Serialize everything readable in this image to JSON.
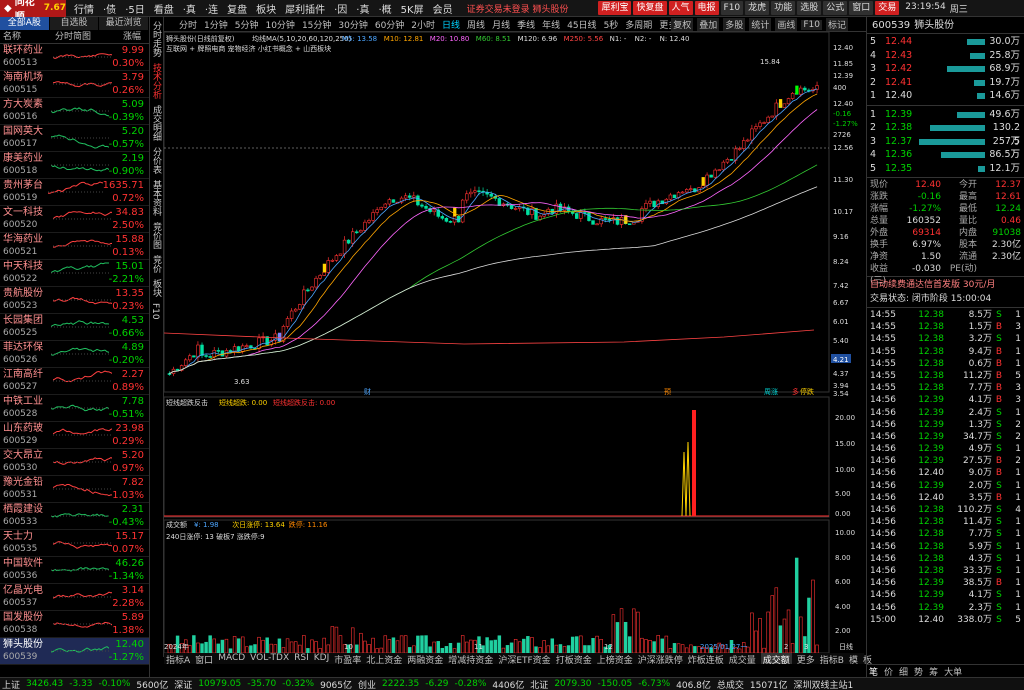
{
  "app": {
    "brand": "同花顺",
    "version": "7.67"
  },
  "menu": [
    "行情",
    "·债",
    "·5日",
    "看盘",
    "·真",
    "·连",
    "复盘",
    "板块",
    "犀利插件",
    "·因",
    "·真",
    "·概",
    "5K屏",
    "会员"
  ],
  "notice": "证券交易未登录  狮头股份",
  "toolbar_buttons": [
    {
      "label": "犀利宝",
      "bg": "#d02020",
      "fg": "#fff"
    },
    {
      "label": "快复盘",
      "bg": "#d02020",
      "fg": "#fff"
    },
    {
      "label": "人气",
      "bg": "#d02020",
      "fg": "#fff"
    },
    {
      "label": "电报",
      "bg": "#d02020",
      "fg": "#fff"
    },
    {
      "label": "F10",
      "bg": "#303030",
      "fg": "#ddd"
    },
    {
      "label": "龙虎",
      "bg": "#303030",
      "fg": "#ddd"
    },
    {
      "label": "功能",
      "bg": "#303030",
      "fg": "#ddd"
    },
    {
      "label": "选股",
      "bg": "#303030",
      "fg": "#ddd"
    },
    {
      "label": "公式",
      "bg": "#303030",
      "fg": "#ddd"
    },
    {
      "label": "窗口",
      "bg": "#303030",
      "fg": "#ddd"
    },
    {
      "label": "交易",
      "bg": "#d02020",
      "fg": "#fff"
    }
  ],
  "clock": {
    "time": "23:19:54",
    "weekday": "周三"
  },
  "left": {
    "tabs": [
      "全部A股",
      "自选股",
      "最近浏览"
    ],
    "headers": [
      "名称",
      "分时简图",
      "涨幅"
    ],
    "stocks": [
      {
        "name": "联环药业",
        "code": "600513",
        "price": "9.99",
        "chg": "0.30%",
        "up": true
      },
      {
        "name": "海南机场",
        "code": "600515",
        "price": "3.79",
        "chg": "0.26%",
        "up": true
      },
      {
        "name": "方大炭素",
        "code": "600516",
        "price": "5.09",
        "chg": "-0.39%",
        "up": false
      },
      {
        "name": "国网英大",
        "code": "600517",
        "price": "5.20",
        "chg": "-0.57%",
        "up": false
      },
      {
        "name": "康美药业",
        "code": "600518",
        "price": "2.19",
        "chg": "-0.90%",
        "up": false
      },
      {
        "name": "贵州茅台",
        "code": "600519",
        "price": "1635.71",
        "chg": "0.72%",
        "up": true
      },
      {
        "name": "文一科技",
        "code": "600520",
        "price": "34.83",
        "chg": "2.50%",
        "up": true
      },
      {
        "name": "华海药业",
        "code": "600521",
        "price": "15.88",
        "chg": "0.13%",
        "up": true
      },
      {
        "name": "中天科技",
        "code": "600522",
        "price": "15.01",
        "chg": "-2.21%",
        "up": false
      },
      {
        "name": "贵航股份",
        "code": "600523",
        "price": "13.35",
        "chg": "0.23%",
        "up": true
      },
      {
        "name": "长园集团",
        "code": "600525",
        "price": "4.53",
        "chg": "-0.66%",
        "up": false
      },
      {
        "name": "菲达环保",
        "code": "600526",
        "price": "4.89",
        "chg": "-0.20%",
        "up": false
      },
      {
        "name": "江南高纤",
        "code": "600527",
        "price": "2.27",
        "chg": "0.89%",
        "up": true
      },
      {
        "name": "中铁工业",
        "code": "600528",
        "price": "7.78",
        "chg": "-0.51%",
        "up": false
      },
      {
        "name": "山东药玻",
        "code": "600529",
        "price": "23.98",
        "chg": "0.29%",
        "up": true
      },
      {
        "name": "交大昂立",
        "code": "600530",
        "price": "5.20",
        "chg": "0.97%",
        "up": true
      },
      {
        "name": "豫光金铅",
        "code": "600531",
        "price": "7.82",
        "chg": "1.03%",
        "up": true
      },
      {
        "name": "栖霞建设",
        "code": "600533",
        "price": "2.31",
        "chg": "-0.43%",
        "up": false
      },
      {
        "name": "天士力",
        "code": "600535",
        "price": "15.17",
        "chg": "0.07%",
        "up": true
      },
      {
        "name": "中国软件",
        "code": "600536",
        "price": "46.26",
        "chg": "-1.34%",
        "up": false
      },
      {
        "name": "亿晶光电",
        "code": "600537",
        "price": "3.14",
        "chg": "2.28%",
        "up": true
      },
      {
        "name": "国发股份",
        "code": "600538",
        "price": "5.89",
        "chg": "1.38%",
        "up": true
      },
      {
        "name": "狮头股份",
        "code": "600539",
        "price": "12.40",
        "chg": "-1.27%",
        "up": false,
        "selected": true
      }
    ]
  },
  "vtabs": [
    "分时走势",
    "技术分析",
    "成交明细",
    "分价表",
    "基本资料",
    "竞价图",
    "竞价",
    "板块",
    "F10"
  ],
  "period_tabs": [
    "分时",
    "1分钟",
    "5分钟",
    "10分钟",
    "15分钟",
    "30分钟",
    "60分钟",
    "2小时",
    "日线",
    "周线",
    "月线",
    "季线",
    "年线",
    "45日线",
    "5秒",
    "多周期",
    "更多"
  ],
  "period_active": "日线",
  "chart_tools": [
    "复权",
    "叠加",
    "多股",
    "统计",
    "画线",
    "F10",
    "标记"
  ],
  "chart": {
    "stock_line": "狮头股份(日线前复权)",
    "ma_label": "均线MA(5,10,20,60,120,250)",
    "ma_values": [
      {
        "t": "M5: 13.58",
        "c": "#4da6ff"
      },
      {
        "t": "M10: 12.81",
        "c": "#ffa500"
      },
      {
        "t": "M20: 10.80",
        "c": "#ff66ff"
      },
      {
        "t": "M60: 8.51",
        "c": "#33cc33"
      },
      {
        "t": "M120: 6.96",
        "c": "#dddddd"
      },
      {
        "t": "M250: 5.56",
        "c": "#ff4444"
      },
      {
        "t": "N1: -",
        "c": "#ddd"
      },
      {
        "t": "N2: -",
        "c": "#ddd"
      },
      {
        "t": "N: 12.40",
        "c": "#ddd"
      }
    ],
    "tags": "互联网 + 牌照电商  宠物经济  小红书概念  + 山西板块",
    "high_mark": "15.84",
    "low_mark": "3.63",
    "last_tag": "4.21",
    "price_axis": [
      "12.40",
      "11.85",
      "12.39",
      "400",
      "12.40",
      "-0.16",
      "-1.27%",
      "2726",
      "12.56",
      "11.30",
      "10.17",
      "9.16",
      "8.24",
      "7.42",
      "6.67",
      "6.01",
      "5.40",
      "4.86",
      "4.37",
      "3.94",
      "3.54"
    ],
    "events": [
      {
        "t": "财",
        "c": "#4da6ff"
      },
      {
        "t": "预",
        "c": "#ff8800"
      },
      {
        "t": "周涨",
        "c": "#00d2d2"
      },
      {
        "t": "多",
        "c": "#ff3232"
      },
      {
        "t": "停跌",
        "c": "#ffd200"
      }
    ],
    "ind1_title": "短线超跌反击",
    "ind1_vals": [
      {
        "t": "短线超跌: 0.00",
        "c": "#ffd200"
      },
      {
        "t": "短线超跌反击: 0.00",
        "c": "#ff3232"
      }
    ],
    "ind1_axis": [
      "20.00",
      "15.00",
      "10.00",
      "5.00",
      "0.00"
    ],
    "vol_title": "成交额",
    "vol_vals": [
      {
        "t": "¥: 1.98",
        "c": "#4da6ff"
      },
      {
        "t": "次日涨停: 13.64",
        "c": "#ffd200"
      },
      {
        "t": "跌停: 11.16",
        "c": "#ff8800"
      }
    ],
    "vol_sub": "240日涨停: 13  破板7  涨跌停:9",
    "vol_axis": [
      "10.00",
      "8.00",
      "6.00",
      "4.00",
      "2.00"
    ],
    "date_labels": [
      "2024年",
      "10",
      "11",
      "12",
      "2025/01/27一",
      "2",
      "3"
    ],
    "corner": "日线"
  },
  "chart_data": {
    "type": "candlestick",
    "title": "狮头股份(日线前复权)",
    "high": 15.84,
    "low": 3.63,
    "last": 12.4
  },
  "bottom_tabs": [
    "指标A",
    "窗口",
    "MACD",
    "VOL-TDX",
    "RSI",
    "KDJ",
    "市盈率",
    "北上资金",
    "两融资金",
    "增减持资金",
    "沪深ETF资金",
    "打板资金",
    "上榜资金",
    "沪深涨跌停",
    "炸板连板",
    "成交量",
    "成交额",
    "更多",
    "指标B",
    "模",
    "板"
  ],
  "bottom_active": "成交额",
  "right": {
    "code": "600539",
    "name": "狮头股份",
    "asks": [
      {
        "l": "5",
        "p": "12.44",
        "v": "30.0万",
        "w": 18
      },
      {
        "l": "4",
        "p": "12.43",
        "v": "25.8万",
        "w": 15
      },
      {
        "l": "3",
        "p": "12.42",
        "v": "68.9万",
        "w": 38
      },
      {
        "l": "2",
        "p": "12.41",
        "v": "19.7万",
        "w": 11
      },
      {
        "l": "1",
        "p": "12.40",
        "v": "14.6万",
        "w": 8
      }
    ],
    "bids": [
      {
        "l": "1",
        "p": "12.39",
        "v": "49.6万",
        "w": 28
      },
      {
        "l": "2",
        "p": "12.38",
        "v": "130.2万",
        "w": 55
      },
      {
        "l": "3",
        "p": "12.37",
        "v": "257.5万",
        "w": 66
      },
      {
        "l": "4",
        "p": "12.36",
        "v": "86.5万",
        "w": 44
      },
      {
        "l": "5",
        "p": "12.35",
        "v": "12.1万",
        "w": 7
      }
    ],
    "quote": [
      [
        "现价",
        "12.40",
        "今开",
        "12.37",
        "r",
        "r"
      ],
      [
        "涨跌",
        "-0.16",
        "最高",
        "12.61",
        "g",
        "r"
      ],
      [
        "涨幅",
        "-1.27%",
        "最低",
        "12.24",
        "g",
        "g"
      ],
      [
        "总量",
        "160352",
        "量比",
        "0.46",
        "w",
        "r"
      ],
      [
        "外盘",
        "69314",
        "内盘",
        "91038",
        "r",
        "g"
      ],
      [
        "换手",
        "6.97%",
        "股本",
        "2.30亿",
        "w",
        "w"
      ],
      [
        "净资",
        "1.50",
        "流通",
        "2.30亿",
        "w",
        "w"
      ],
      [
        "收益(三)",
        "-0.030",
        "PE(动)",
        "",
        "w",
        "w"
      ]
    ],
    "info1": "自动续费通达信首发版   30元/月",
    "info2": "交易状态: 闭市阶段 15:00:04",
    "ticks": [
      [
        "14:55",
        "12.38",
        "8.5万",
        "S",
        "1"
      ],
      [
        "14:55",
        "12.38",
        "1.5万",
        "B",
        "3"
      ],
      [
        "14:55",
        "12.38",
        "3.2万",
        "S",
        "1"
      ],
      [
        "14:55",
        "12.38",
        "9.4万",
        "B",
        "1"
      ],
      [
        "14:55",
        "12.38",
        "0.6万",
        "B",
        "1"
      ],
      [
        "14:55",
        "12.38",
        "11.2万",
        "B",
        "5"
      ],
      [
        "14:55",
        "12.38",
        "7.7万",
        "B",
        "3"
      ],
      [
        "14:56",
        "12.39",
        "4.1万",
        "B",
        "3"
      ],
      [
        "14:56",
        "12.39",
        "2.4万",
        "S",
        "1"
      ],
      [
        "14:56",
        "12.39",
        "1.3万",
        "S",
        "2"
      ],
      [
        "14:56",
        "12.39",
        "34.7万",
        "S",
        "2"
      ],
      [
        "14:56",
        "12.39",
        "4.9万",
        "S",
        "1"
      ],
      [
        "14:56",
        "12.39",
        "27.5万",
        "B",
        "2"
      ],
      [
        "14:56",
        "12.40",
        "9.0万",
        "B",
        "1"
      ],
      [
        "14:56",
        "12.39",
        "2.0万",
        "S",
        "1"
      ],
      [
        "14:56",
        "12.40",
        "3.5万",
        "B",
        "1"
      ],
      [
        "14:56",
        "12.38",
        "110.2万",
        "S",
        "4"
      ],
      [
        "14:56",
        "12.38",
        "11.4万",
        "S",
        "1"
      ],
      [
        "14:56",
        "12.38",
        "7.7万",
        "S",
        "1"
      ],
      [
        "14:56",
        "12.38",
        "5.9万",
        "S",
        "1"
      ],
      [
        "14:56",
        "12.38",
        "4.3万",
        "S",
        "1"
      ],
      [
        "14:56",
        "12.38",
        "33.3万",
        "S",
        "1"
      ],
      [
        "14:56",
        "12.39",
        "38.5万",
        "B",
        "1"
      ],
      [
        "14:56",
        "12.39",
        "4.1万",
        "S",
        "1"
      ],
      [
        "14:56",
        "12.39",
        "2.3万",
        "S",
        "1"
      ],
      [
        "15:00",
        "12.40",
        "338.0万",
        "S",
        "5"
      ]
    ]
  },
  "right_bottom_tabs": [
    "笔",
    "价",
    "细",
    "势",
    "筹",
    "大单"
  ],
  "status": {
    "items": [
      {
        "t": "上证",
        "c": "#ddd"
      },
      {
        "t": "3426.43",
        "c": "#00d200"
      },
      {
        "t": "-3.33",
        "c": "#00d200"
      },
      {
        "t": "-0.10%",
        "c": "#00d200"
      },
      {
        "t": "5600亿",
        "c": "#ddd"
      },
      {
        "t": "深证",
        "c": "#ddd"
      },
      {
        "t": "10979.05",
        "c": "#00d200"
      },
      {
        "t": "-35.70",
        "c": "#00d200"
      },
      {
        "t": "-0.32%",
        "c": "#00d200"
      },
      {
        "t": "9065亿",
        "c": "#ddd"
      },
      {
        "t": "创业",
        "c": "#ddd"
      },
      {
        "t": "2222.35",
        "c": "#00d200"
      },
      {
        "t": "-6.29",
        "c": "#00d200"
      },
      {
        "t": "-0.28%",
        "c": "#00d200"
      },
      {
        "t": "4406亿",
        "c": "#ddd"
      },
      {
        "t": "北证",
        "c": "#ddd"
      },
      {
        "t": "2079.30",
        "c": "#00d200"
      },
      {
        "t": "-150.05",
        "c": "#00d200"
      },
      {
        "t": "-6.73%",
        "c": "#00d200"
      },
      {
        "t": "406.8亿",
        "c": "#ddd"
      },
      {
        "t": "总成交",
        "c": "#ddd"
      },
      {
        "t": "15071亿",
        "c": "#ddd"
      },
      {
        "t": "深圳双线主站1",
        "c": "#ddd"
      }
    ]
  }
}
